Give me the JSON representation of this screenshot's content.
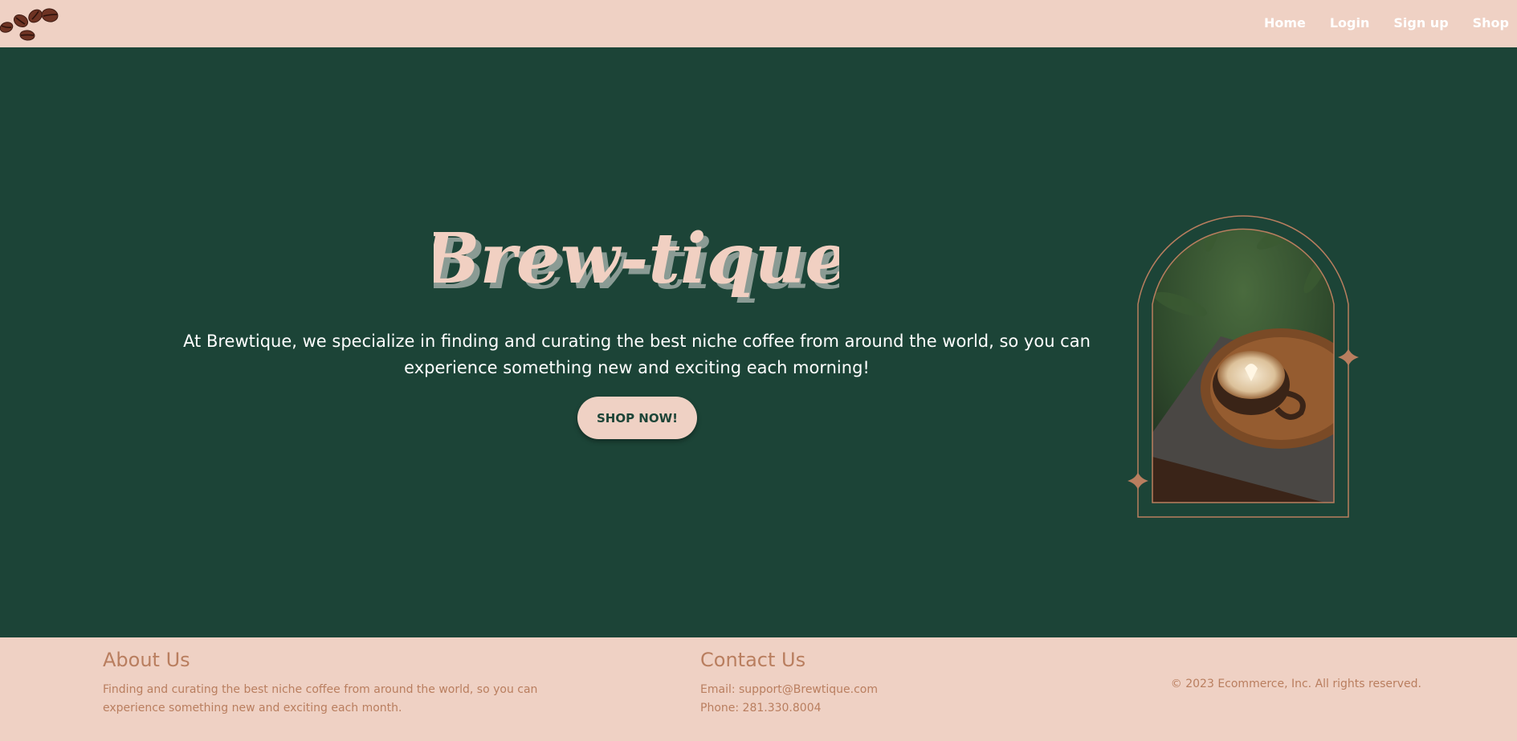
{
  "brand": {
    "name": "Brew-tique",
    "logo_icon": "coffee-beans-icon"
  },
  "nav": {
    "items": [
      {
        "label": "Home"
      },
      {
        "label": "Login"
      },
      {
        "label": "Sign up"
      },
      {
        "label": "Shop"
      }
    ]
  },
  "hero": {
    "title": "Brew-tique",
    "tagline": "At Brewtique, we specialize in finding and curating the best niche coffee from around the world, so you can experience something new and exciting each morning!",
    "cta_label": "SHOP NOW!",
    "image_icon": "latte-cup-image",
    "sparkle_icon": "sparkle-icon"
  },
  "footer": {
    "about": {
      "heading": "About Us",
      "text": "Finding and curating the best niche coffee from around the world, so you can experience something new and exciting each month."
    },
    "contact": {
      "heading": "Contact Us",
      "email": "Email: support@Brewtique.com",
      "phone": "Phone: 281.330.8004"
    },
    "copyright": "© 2023 Ecommerce, Inc. All rights reserved."
  },
  "colors": {
    "nav_bg": "#efd1c4",
    "hero_bg": "#1c4437",
    "title_fill": "#f1d0c2",
    "title_shadow": "#8a9b94",
    "accent": "#b97e5f",
    "nav_text": "#ffffff"
  }
}
